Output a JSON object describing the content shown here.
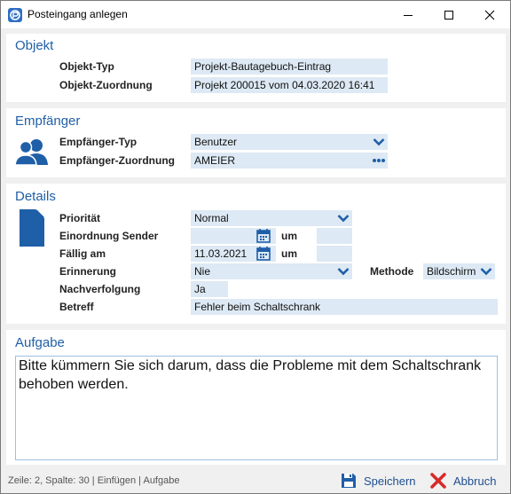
{
  "window": {
    "title": "Posteingang anlegen"
  },
  "colors": {
    "accent": "#1f5fa8",
    "field_bg": "#dde9f4",
    "cancel_red": "#d62b2b"
  },
  "objekt": {
    "title": "Objekt",
    "typ_label": "Objekt-Typ",
    "typ_value": "Projekt-Bautagebuch-Eintrag",
    "zuordnung_label": "Objekt-Zuordnung",
    "zuordnung_value": "Projekt 200015 vom 04.03.2020 16:41"
  },
  "empfaenger": {
    "title": "Empfänger",
    "icon": "users-icon",
    "typ_label": "Empfänger-Typ",
    "typ_value": "Benutzer",
    "zuordnung_label": "Empfänger-Zuordnung",
    "zuordnung_value": "AMEIER"
  },
  "details": {
    "title": "Details",
    "icon": "document-icon",
    "prioritaet_label": "Priorität",
    "prioritaet_value": "Normal",
    "sender_label": "Einordnung Sender",
    "sender_date": "",
    "um_label": "um",
    "sender_time": "",
    "faellig_label": "Fällig am",
    "faellig_date": "11.03.2021",
    "faellig_time": "",
    "erinnerung_label": "Erinnerung",
    "erinnerung_value": "Nie",
    "methode_label": "Methode",
    "methode_value": "Bildschirm",
    "nachverfolgung_label": "Nachverfolgung",
    "nachverfolgung_value": "Ja",
    "betreff_label": "Betreff",
    "betreff_value": "Fehler beim Schaltschrank"
  },
  "aufgabe": {
    "title": "Aufgabe",
    "text": "Bitte kümmern Sie sich darum, dass die Probleme mit dem Schaltschrank behoben werden."
  },
  "status": {
    "text": "Zeile: 2,  Spalte: 30 | Einfügen | Aufgabe",
    "save_label": "Speichern",
    "cancel_label": "Abbruch"
  }
}
